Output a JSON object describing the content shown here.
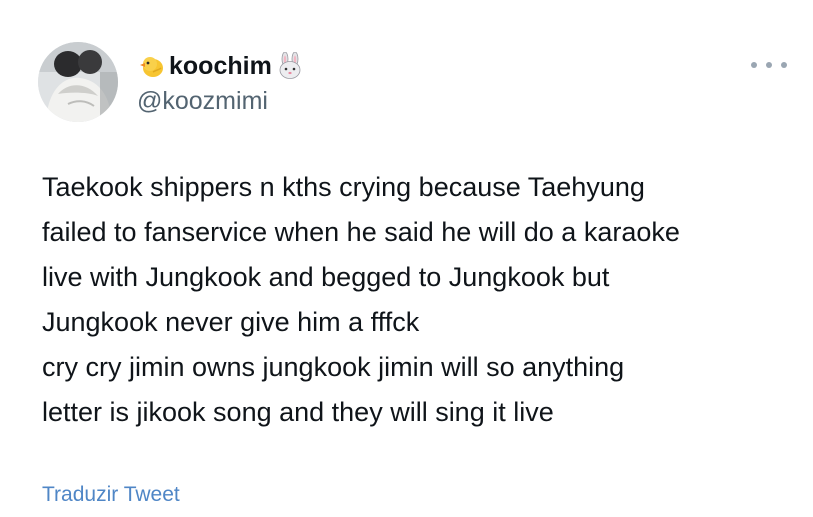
{
  "author": {
    "display_name": "koochim",
    "handle": "@koozmimi",
    "name_prefix_icon": "chick-emoji-icon",
    "name_suffix_icon": "rabbit-emoji-icon"
  },
  "tweet": {
    "lines": [
      "Taekook shippers n kths crying because Taehyung",
      "failed to fanservice when he said he will do a karaoke",
      "live with Jungkook and begged to Jungkook but",
      "Jungkook never give him a fffck",
      "cry cry jimin owns jungkook jimin will so anything",
      "letter is jikook song and they will sing it live"
    ]
  },
  "actions": {
    "translate_label": "Traduzir Tweet",
    "more_icon": "more-options-icon"
  },
  "colors": {
    "text": "#0f1419",
    "secondary": "#536471",
    "link": "#4f86c6"
  }
}
